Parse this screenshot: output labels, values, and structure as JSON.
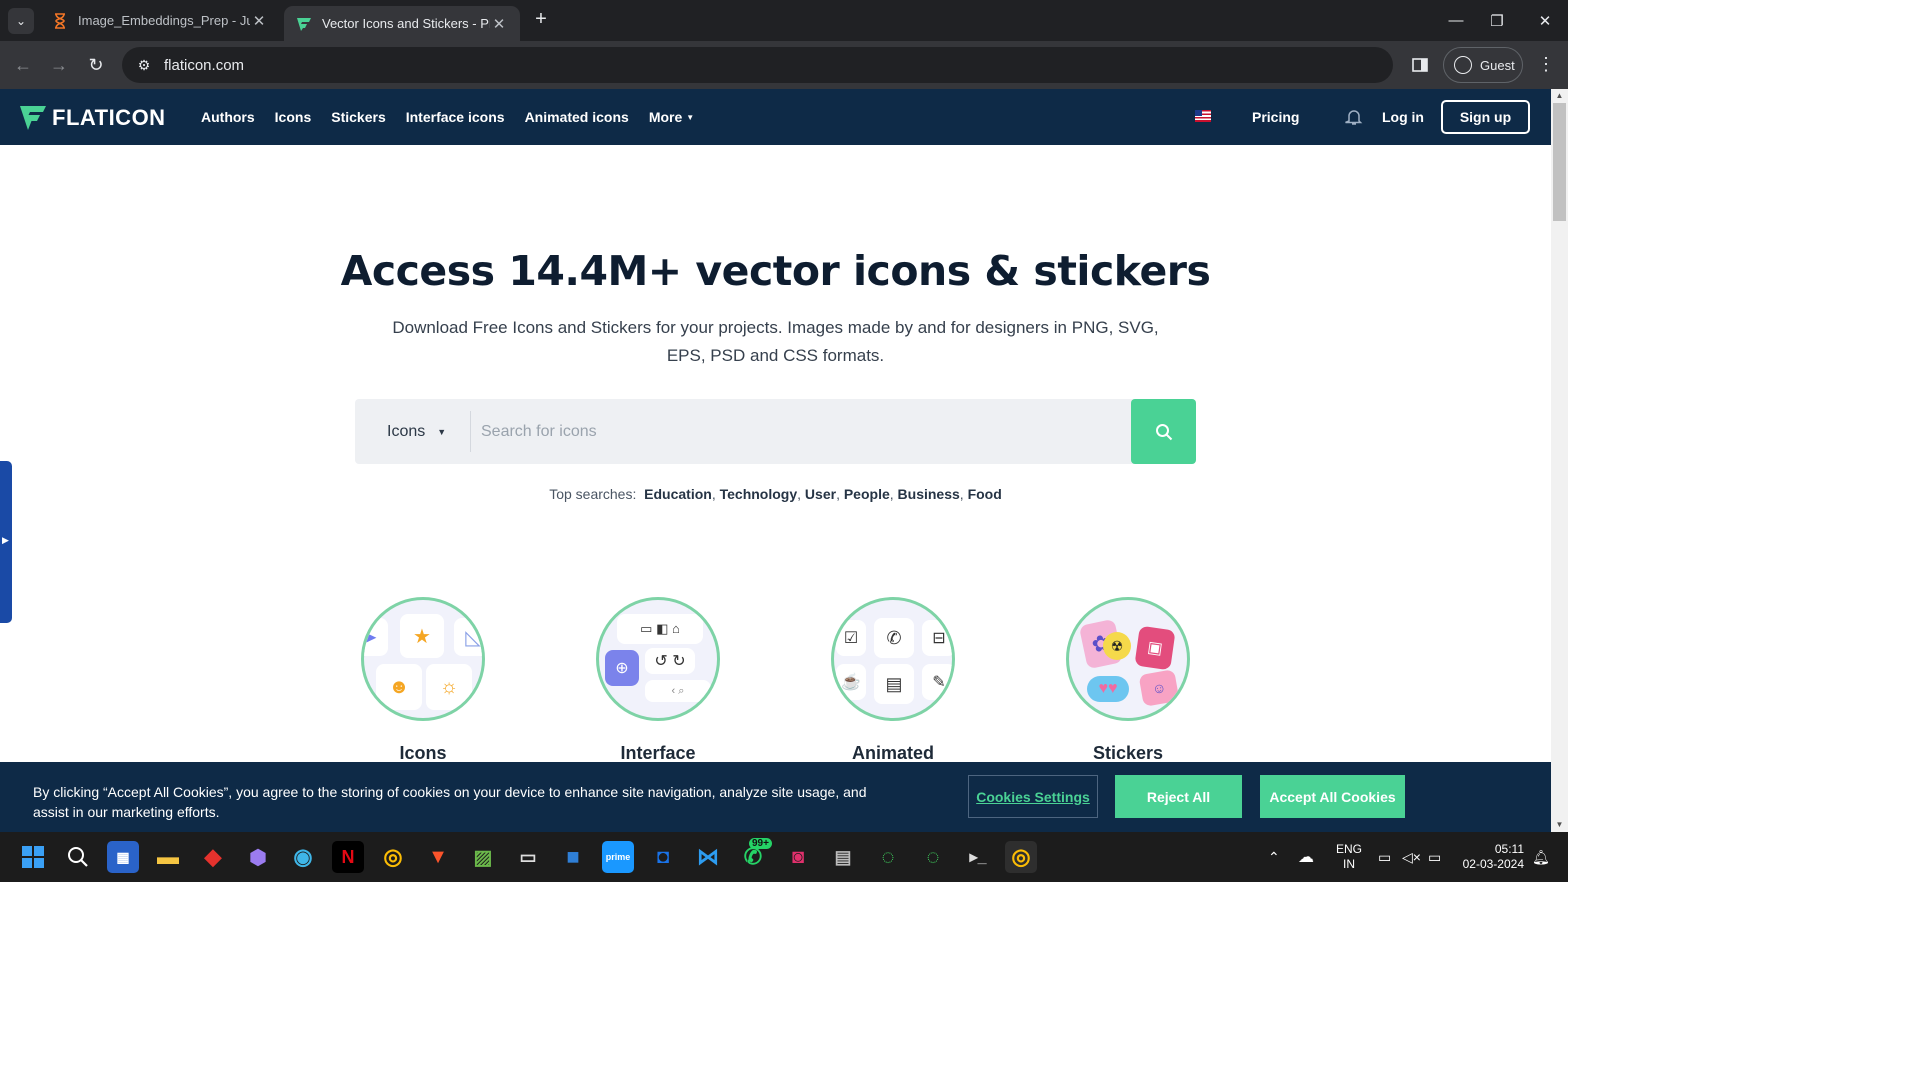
{
  "browser": {
    "tabs": [
      {
        "title": "Image_Embeddings_Prep - Jupy",
        "icon": "hourglass-icon"
      },
      {
        "title": "Vector Icons and Stickers - PNG",
        "icon": "flaticon-icon"
      }
    ],
    "url": "flaticon.com",
    "profile": "Guest"
  },
  "site": {
    "logo": "FLATICON",
    "nav": [
      "Authors",
      "Icons",
      "Stickers",
      "Interface icons",
      "Animated icons",
      "More"
    ],
    "pricing": "Pricing",
    "login": "Log in",
    "signup": "Sign up"
  },
  "hero": {
    "title": "Access 14.4M+ vector icons & stickers",
    "subtitle": "Download Free Icons and Stickers for your projects. Images made by and for designers in PNG, SVG, EPS, PSD and CSS formats."
  },
  "search": {
    "type": "Icons",
    "placeholder": "Search for icons",
    "top_label": "Top searches:",
    "top": [
      "Education",
      "Technology",
      "User",
      "People",
      "Business",
      "Food"
    ]
  },
  "categories": [
    "Icons",
    "Interface Icons",
    "Animated Icons",
    "Stickers"
  ],
  "cookie": {
    "text": "By clicking “Accept All Cookies”, you agree to the storing of cookies on your device to enhance site navigation, analyze site usage, and assist in our marketing efforts.",
    "settings": "Cookies Settings",
    "reject": "Reject All",
    "accept": "Accept All Cookies"
  },
  "taskbar": {
    "whatsapp_badge": "99+",
    "lang": "ENG",
    "region": "IN",
    "time": "05:11",
    "date": "02-03-2024"
  },
  "colors": {
    "brand_navy": "#0e2a47",
    "accent_green": "#4ad295"
  }
}
